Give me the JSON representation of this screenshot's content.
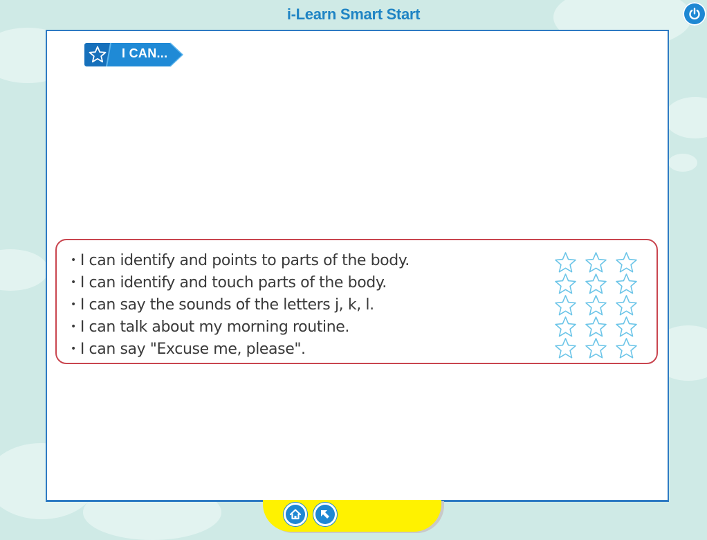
{
  "app": {
    "title": "i-Learn Smart Start"
  },
  "icons": {
    "power": "power-icon",
    "home": "home-icon",
    "back": "back-arrow-icon",
    "star": "star-outline-icon"
  },
  "colors": {
    "accent": "#1e88d3",
    "checklist_border": "#c9454f",
    "star_outline": "#6cc5e8",
    "nav_bar": "#fff200"
  },
  "lesson": {
    "banner_label": "I CAN...",
    "items": [
      {
        "bullet": "•",
        "text": "I can identify and points to parts of the body.",
        "stars": 3
      },
      {
        "bullet": "•",
        "text": "I can identify and touch parts of the body.",
        "stars": 3
      },
      {
        "bullet": "•",
        "text": "I can say the sounds of the letters j, k, l.",
        "stars": 3
      },
      {
        "bullet": "•",
        "text": "I can talk about my morning routine.",
        "stars": 3
      },
      {
        "bullet": "•",
        "text": "I can say \"Excuse me, please\".",
        "stars": 3
      }
    ]
  }
}
